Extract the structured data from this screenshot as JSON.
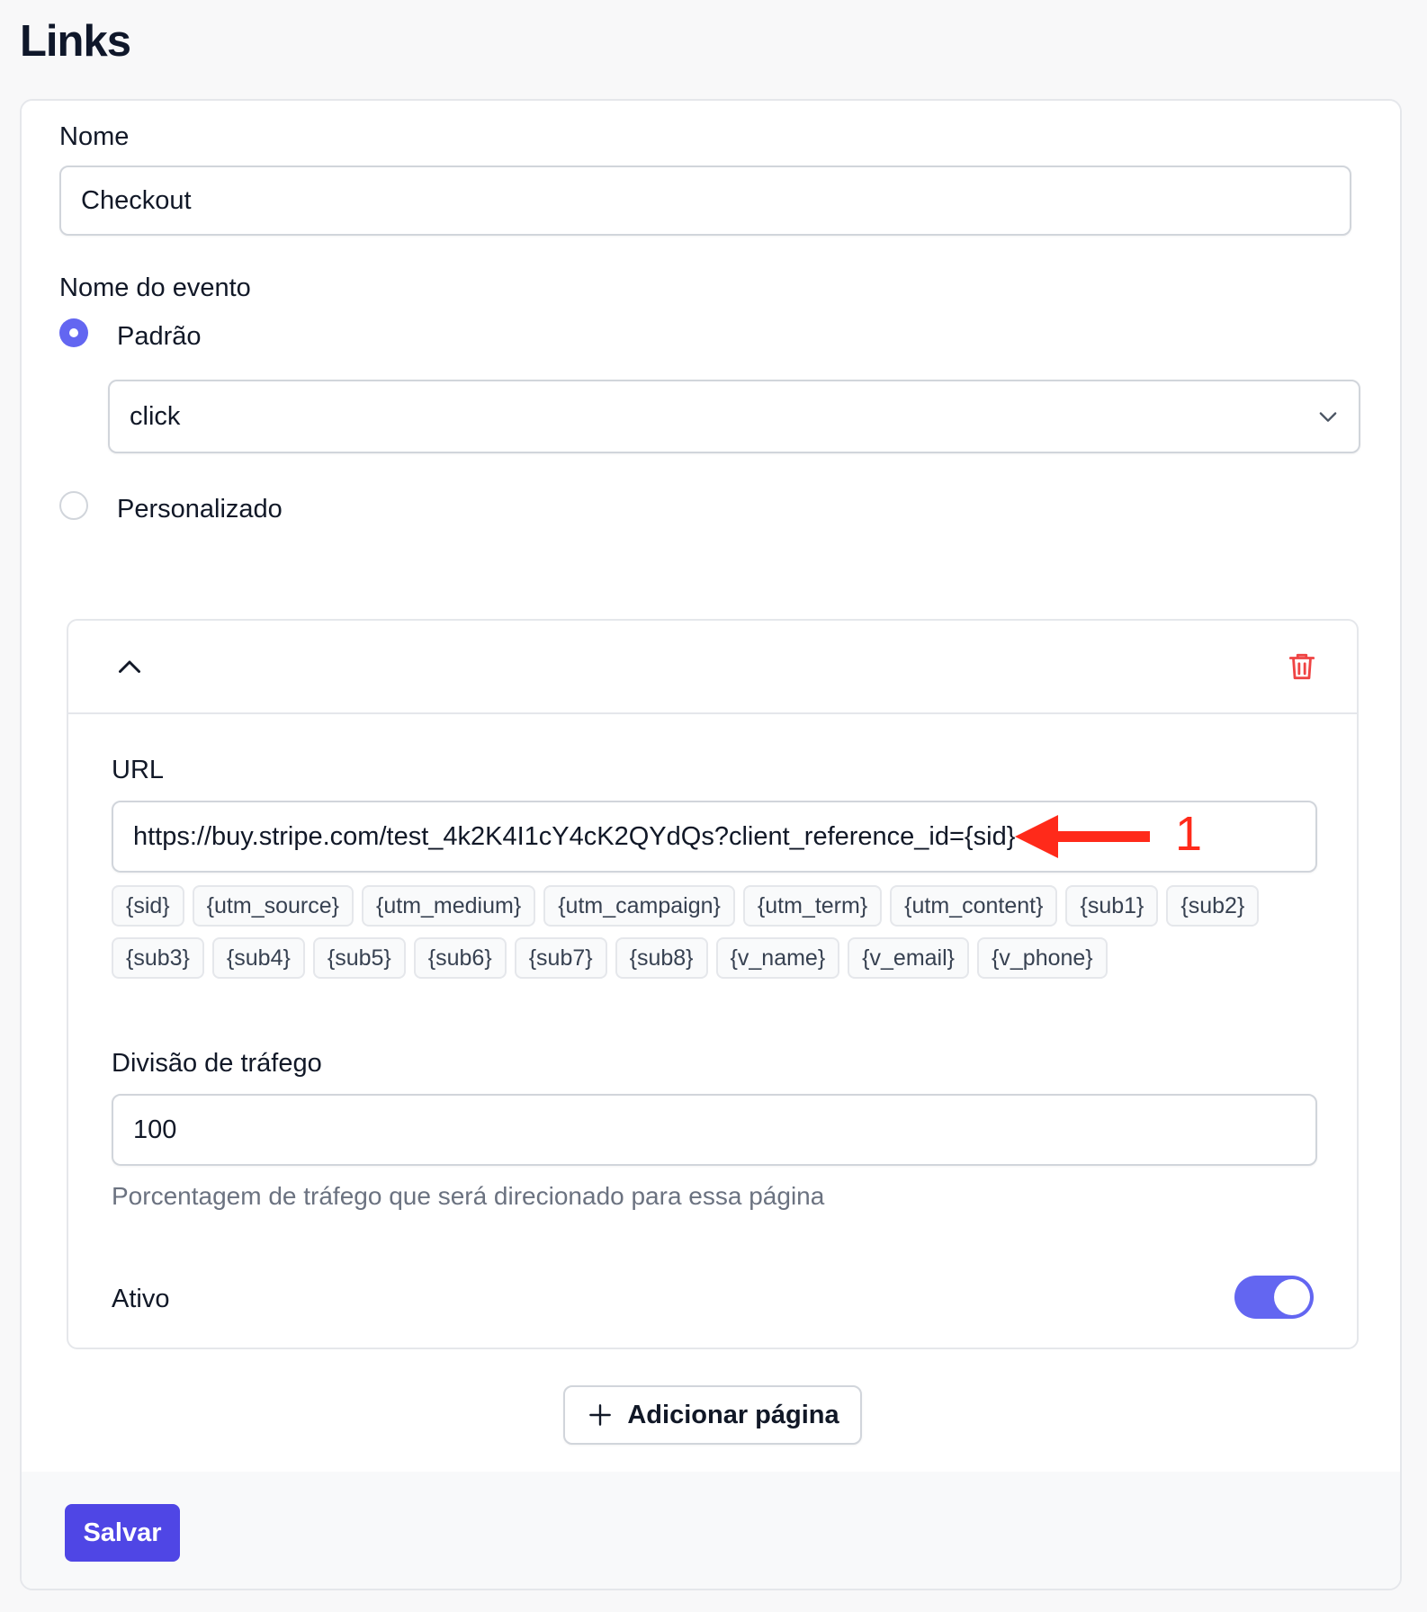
{
  "page": {
    "title": "Links"
  },
  "form": {
    "name_label": "Nome",
    "name_value": "Checkout",
    "event_label": "Nome do evento",
    "radio_default_label": "Padrão",
    "event_select_value": "click",
    "radio_custom_label": "Personalizado"
  },
  "panel": {
    "url_label": "URL",
    "url_value": "https://buy.stripe.com/test_4k2K4I1cY4cK2QYdQs?client_reference_id={sid}",
    "chips_row1": [
      "{sid}",
      "{utm_source}",
      "{utm_medium}",
      "{utm_campaign}",
      "{utm_term}",
      "{utm_content}",
      "{sub1}",
      "{sub2}"
    ],
    "chips_row2": [
      "{sub3}",
      "{sub4}",
      "{sub5}",
      "{sub6}",
      "{sub7}",
      "{sub8}",
      "{v_name}",
      "{v_email}",
      "{v_phone}"
    ],
    "traffic_label": "Divisão de tráfego",
    "traffic_value": "100",
    "traffic_help": "Porcentagem de tráfego que será direcionado para essa página",
    "active_label": "Ativo",
    "active": true
  },
  "actions": {
    "add_page_label": "Adicionar página",
    "save_label": "Salvar"
  },
  "annotation": {
    "number": "1"
  },
  "colors": {
    "accent": "#6366f1",
    "primary_button": "#4f46e5",
    "danger": "#ef4444",
    "annotation": "#ff2a1a"
  }
}
